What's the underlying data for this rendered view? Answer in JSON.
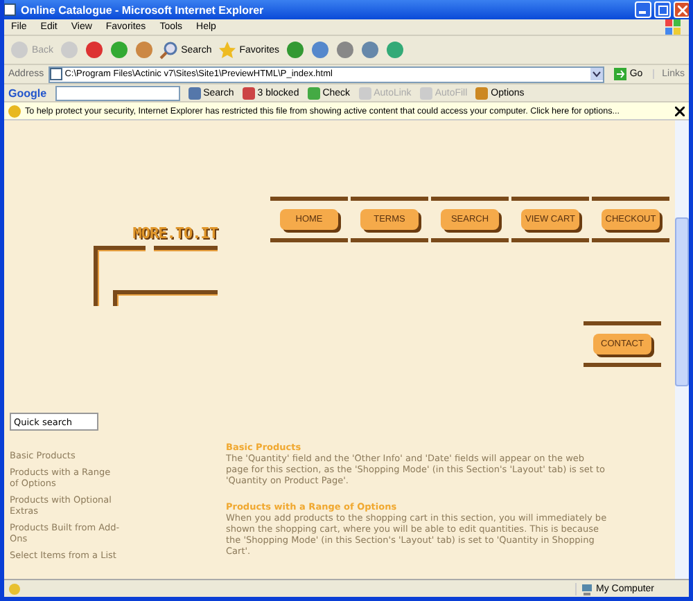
{
  "window": {
    "title": "Online Catalogue - Microsoft Internet Explorer"
  },
  "menu_bar": [
    "File",
    "Edit",
    "View",
    "Favorites",
    "Tools",
    "Help"
  ],
  "toolbar": [
    {
      "kind": "back",
      "label": "Back",
      "disabled": true
    },
    {
      "kind": "forward",
      "disabled": true
    },
    {
      "kind": "stop",
      "disabled": false
    },
    {
      "kind": "refresh",
      "disabled": false
    },
    {
      "kind": "home",
      "disabled": false
    },
    {
      "kind": "search",
      "label": "Search",
      "disabled": false
    },
    {
      "kind": "favorites",
      "label": "Favorites",
      "disabled": false
    },
    {
      "kind": "history",
      "disabled": false
    },
    {
      "kind": "mail",
      "disabled": false
    },
    {
      "kind": "print",
      "disabled": false
    },
    {
      "kind": "edit",
      "disabled": false
    },
    {
      "kind": "messenger",
      "disabled": false
    }
  ],
  "address_bar": {
    "label": "Address",
    "value": "C:\\Program Files\\Actinic v7\\Sites\\Site1\\PreviewHTML\\P_index.html",
    "go": "Go",
    "links": "Links"
  },
  "google_toolbar": {
    "logo": "Google",
    "items": [
      {
        "kind": "search",
        "label": "Search",
        "disabled": false
      },
      {
        "kind": "blocked",
        "label": "3 blocked",
        "disabled": false
      },
      {
        "kind": "check",
        "label": "Check",
        "disabled": false
      },
      {
        "kind": "autolink",
        "label": "AutoLink",
        "disabled": true
      },
      {
        "kind": "autofill",
        "label": "AutoFill",
        "disabled": true
      },
      {
        "kind": "options",
        "label": "Options",
        "disabled": false
      }
    ]
  },
  "info_bar": "To help protect your security, Internet Explorer has restricted this file from showing active content that could access your computer. Click here for options...",
  "page": {
    "logo": "MORE.TO.IT",
    "nav": [
      "HOME",
      "TERMS",
      "SEARCH",
      "VIEW CART",
      "CHECKOUT"
    ],
    "contact": "CONTACT",
    "quick_search": {
      "placeholder": "Quick search"
    },
    "sidebar": [
      "Basic Products",
      "Products with a Range of Options",
      "Products with Optional Extras",
      "Products Built from Add-Ons",
      "Select Items from a List"
    ],
    "sections": [
      {
        "heading": "Basic Products",
        "body": "The 'Quantity' field and the 'Other Info' and 'Date' fields will appear on the web page for this section, as the 'Shopping Mode' (in this Section's 'Layout' tab) is set to 'Quantity on Product Page'."
      },
      {
        "heading": "Products with a Range of Options",
        "body": "When you add products to the shopping cart in this section, you will immediately be shown the shopping cart, where you will be able to edit quantities. This is because the 'Shopping Mode' (in this Section's 'Layout' tab) is set to 'Quantity in Shopping Cart'."
      }
    ]
  },
  "status_bar": {
    "zone": "My Computer"
  }
}
